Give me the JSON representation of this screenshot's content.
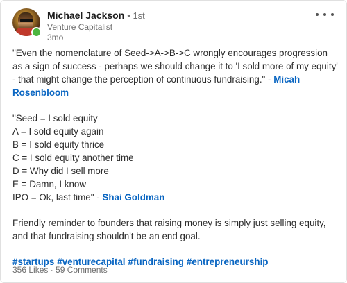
{
  "author": {
    "name": "Michael Jackson",
    "degree": "• 1st",
    "headline": "Venture Capitalist",
    "time": "3mo",
    "avatar_icon": "profile-photo",
    "status_color": "#4cb53f"
  },
  "menu": {
    "icon": "more-horizontal-icon"
  },
  "post": {
    "quote1": {
      "line1": "\"Even the nomenclature of Seed->A->B->C wrongly encourages progression",
      "line2": "as a sign of success - perhaps we should change it to 'I sold more of my equity'",
      "line3": "- that might change the perception of continuous fundraising.\" - ",
      "mention_part1": "Micah",
      "mention_part2": "Rosenbloom"
    },
    "quote2": {
      "lines": [
        "\"Seed = I sold equity",
        "A = I sold equity again",
        "B = I sold equity thrice",
        "C = I sold equity another time",
        "D = Why did I sell more",
        "E = Damn, I know"
      ],
      "last_line": "IPO = Ok, last time\" - ",
      "mention": "Shai Goldman"
    },
    "reminder": {
      "line1": "Friendly reminder to founders that raising money is simply just selling equity,",
      "line2": "and that fundraising shouldn't be an end goal."
    },
    "hashtags": [
      "#startups",
      "#venturecapital",
      "#fundraising",
      "#entrepreneurship"
    ]
  },
  "social": {
    "likes": "356 Likes",
    "separator": " · ",
    "comments": "59 Comments"
  },
  "colors": {
    "link": "#0a66c2",
    "text": "#2c2c2c",
    "muted": "#6e6e6e"
  }
}
